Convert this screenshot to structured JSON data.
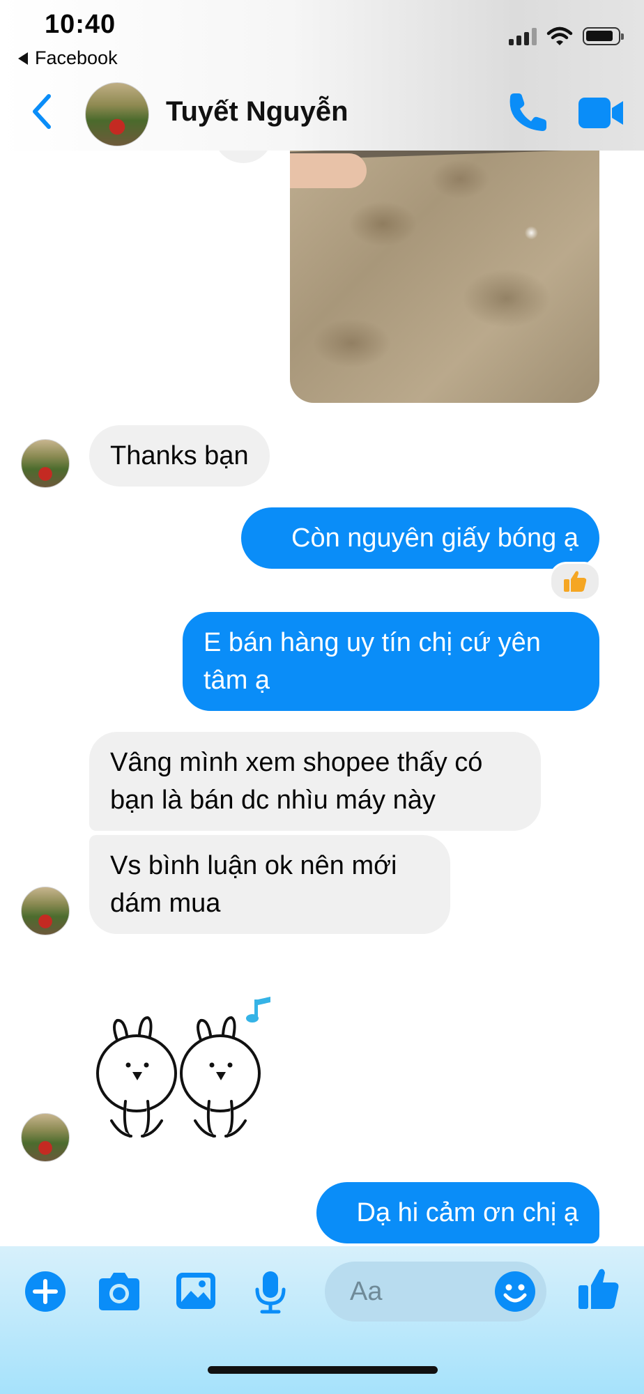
{
  "status_bar": {
    "time": "10:40",
    "back_app": "Facebook"
  },
  "header": {
    "contact_name": "Tuyết Nguyễn"
  },
  "messages": [
    {
      "side": "in",
      "text": "Thanks bạn"
    },
    {
      "side": "out",
      "text": "Còn nguyên giấy bóng ạ",
      "reaction": "thumbs-up"
    },
    {
      "side": "out",
      "line1": "E bán hàng uy tín chị cứ yên",
      "line2": "tâm ạ"
    },
    {
      "side": "in",
      "line1": "Vâng mình xem shopee thấy có",
      "line2": "bạn là bán dc nhìu máy này"
    },
    {
      "side": "in",
      "line1": "Vs bình luận ok nên mới",
      "line2": "dám mua"
    },
    {
      "side": "out",
      "text": "Dạ hi cảm ơn chị ạ"
    }
  ],
  "composer": {
    "placeholder": "Aa"
  },
  "colors": {
    "accent": "#0a8df8",
    "incoming_bubble": "#f0f0f0"
  }
}
